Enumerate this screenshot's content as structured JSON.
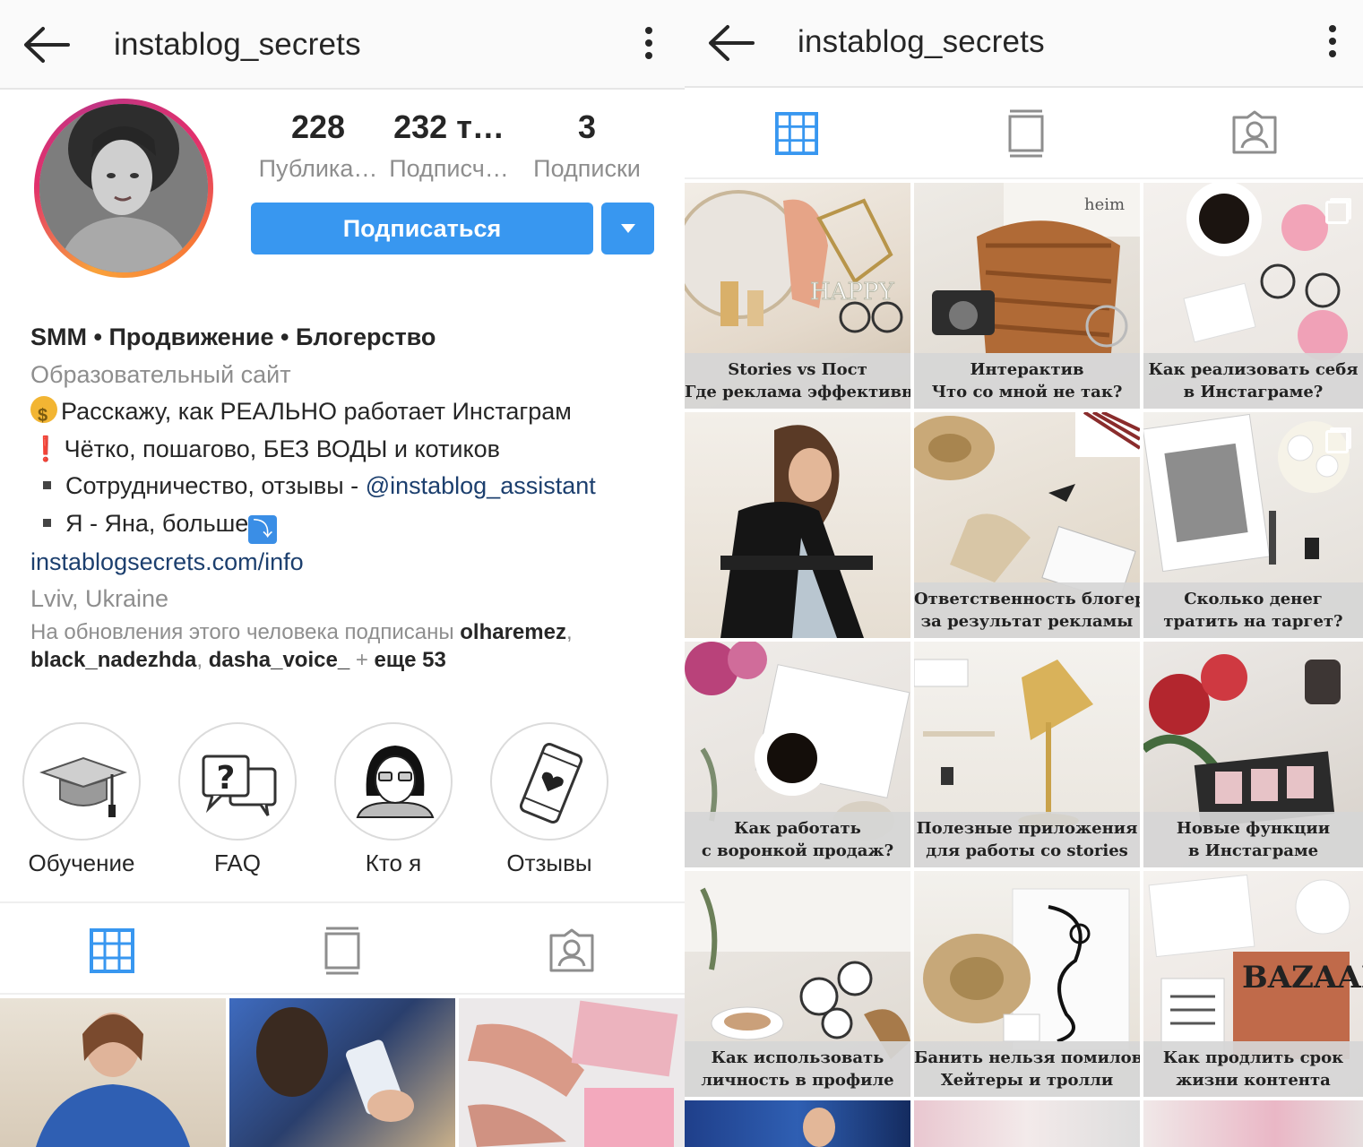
{
  "left": {
    "header": {
      "title": "instablog_secrets"
    },
    "stats": [
      {
        "value": "228",
        "label": "Публика…"
      },
      {
        "value": "232 т…",
        "label": "Подписч…"
      },
      {
        "value": "3",
        "label": "Подписки"
      }
    ],
    "follow_label": "Подписаться",
    "bio": {
      "name": "SMM • Продвижение • Блогерство",
      "category": "Образовательный сайт",
      "line1": "Расскажу, как РЕАЛЬНО работает Инстаграм",
      "line2": "Чётко, пошагово, БЕЗ ВОДЫ и котиков",
      "line3_prefix": "Сотрудничество, отзывы - ",
      "line3_mention": "@instablog_assistant",
      "line4": "Я - Яна, больше",
      "link": "instablogsecrets.com/info",
      "location": "Lviv, Ukraine"
    },
    "followed_by": {
      "prefix": "На обновления этого человека подписаны ",
      "user1": "olharemez",
      "sep1": ",",
      "user2": "black_nadezhda",
      "sep2": ", ",
      "user3": "dasha_voice_",
      "plus": " + ",
      "more": "еще 53"
    },
    "highlights": [
      {
        "label": "Обучение",
        "icon": "graduation-cap-icon"
      },
      {
        "label": "FAQ",
        "icon": "question-chat-icon"
      },
      {
        "label": "Кто я",
        "icon": "person-glasses-icon"
      },
      {
        "label": "Отзывы",
        "icon": "phone-heart-icon"
      }
    ]
  },
  "right": {
    "header": {
      "title": "instablog_secrets"
    },
    "posts": [
      {
        "l1": "Stories vs Пост",
        "l2": "Где реклама эффективней?"
      },
      {
        "l1": "Интерактив",
        "l2": "Что со мной не так?"
      },
      {
        "l1": "Как реализовать себя",
        "l2": "в Инстаграме?"
      },
      {
        "l1": "",
        "l2": ""
      },
      {
        "l1": "Ответственность блогеров",
        "l2": "за результат рекламы"
      },
      {
        "l1": "Сколько денег",
        "l2": "тратить на таргет?"
      },
      {
        "l1": "Как работать",
        "l2": "с воронкой продаж?"
      },
      {
        "l1": "Полезные приложения",
        "l2": "для работы со stories"
      },
      {
        "l1": "Новые функции",
        "l2": "в Инстаграме"
      },
      {
        "l1": "Как использовать",
        "l2": "личность в профиле"
      },
      {
        "l1": "Банить нельзя помиловать",
        "l2": "Хейтеры и тролли"
      },
      {
        "l1": "Как продлить срок",
        "l2": "жизни контента"
      }
    ]
  },
  "colors": {
    "accent": "#3897f0",
    "text": "#262626",
    "muted": "#8e8e8e",
    "link": "#1c3f6e"
  }
}
